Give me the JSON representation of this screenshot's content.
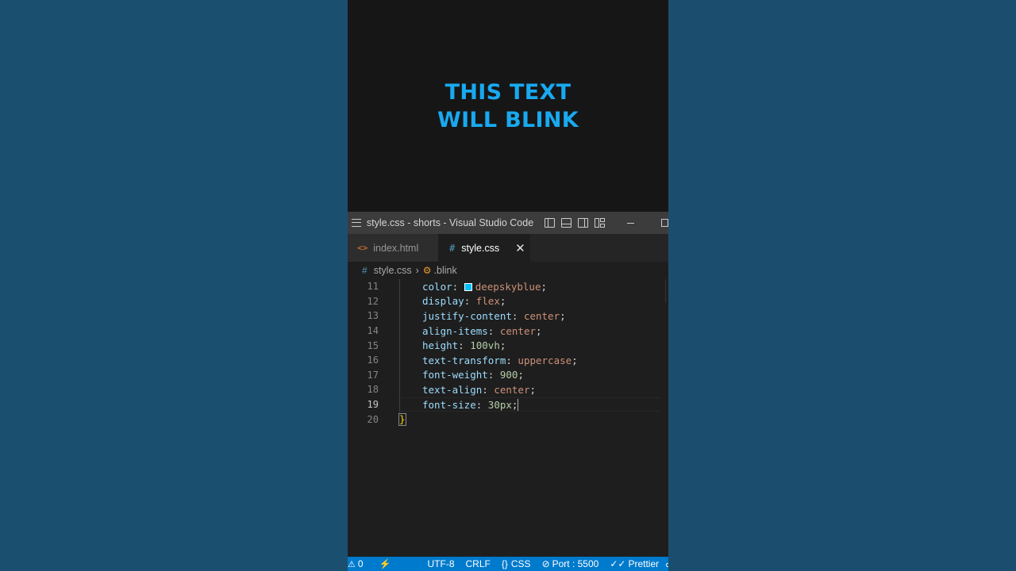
{
  "preview": {
    "text_line1": "THIS TEXT",
    "text_line2": "WILL BLINK",
    "color": "#18a9f0"
  },
  "window": {
    "title": "style.css - shorts - Visual Studio Code"
  },
  "tabs": [
    {
      "label": "index.html",
      "icon": "html-file-icon",
      "active": false
    },
    {
      "label": "style.css",
      "icon": "css-file-icon",
      "active": true
    }
  ],
  "breadcrumb": {
    "file": "style.css",
    "symbol": ".blink"
  },
  "editor": {
    "lines": [
      {
        "num": "11",
        "prop": "color",
        "value": "deepskyblue",
        "swatch": "#00bfff"
      },
      {
        "num": "12",
        "prop": "display",
        "value": "flex"
      },
      {
        "num": "13",
        "prop": "justify-content",
        "value": "center"
      },
      {
        "num": "14",
        "prop": "align-items",
        "value": "center"
      },
      {
        "num": "15",
        "prop": "height",
        "value": "100vh"
      },
      {
        "num": "16",
        "prop": "text-transform",
        "value": "uppercase"
      },
      {
        "num": "17",
        "prop": "font-weight",
        "value": "900"
      },
      {
        "num": "18",
        "prop": "text-align",
        "value": "center"
      },
      {
        "num": "19",
        "prop": "font-size",
        "value": "30px",
        "active": true
      },
      {
        "num": "20",
        "closing": "}"
      }
    ]
  },
  "statusbar": {
    "problems": "0",
    "encoding": "UTF-8",
    "eol": "CRLF",
    "language": "CSS",
    "port": "Port : 5500",
    "formatter": "Prettier",
    "accent": "#007acc"
  }
}
